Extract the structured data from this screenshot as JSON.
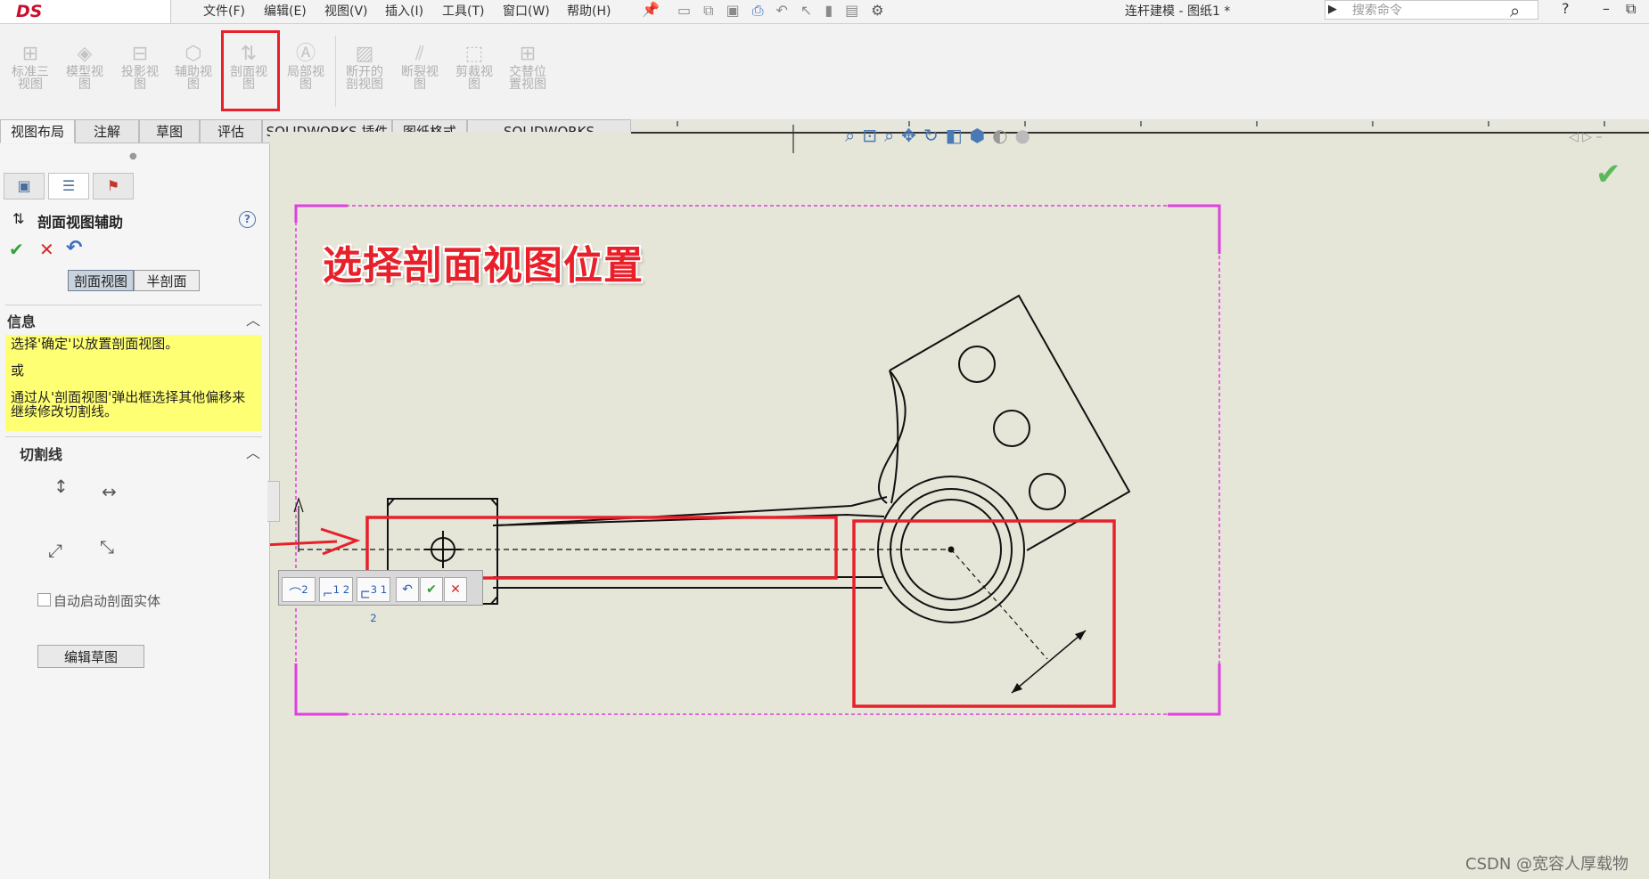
{
  "app": {
    "logo_text": "DS SOLIDWORKS",
    "window_title": "连杆建模 - 图纸1 *",
    "search_placeholder": "搜索命令",
    "help_symbol": "?"
  },
  "menu": [
    "文件(F)",
    "编辑(E)",
    "视图(V)",
    "插入(I)",
    "工具(T)",
    "窗口(W)",
    "帮助(H)"
  ],
  "ribbon": {
    "buttons": [
      {
        "l1": "标准三",
        "l2": "视图"
      },
      {
        "l1": "模型视",
        "l2": "图"
      },
      {
        "l1": "投影视",
        "l2": "图"
      },
      {
        "l1": "辅助视",
        "l2": "图"
      },
      {
        "l1": "剖面视",
        "l2": "图"
      },
      {
        "l1": "局部视",
        "l2": "图"
      },
      {
        "l1": "断开的",
        "l2": "剖视图"
      },
      {
        "l1": "断裂视",
        "l2": "图"
      },
      {
        "l1": "剪裁视",
        "l2": "图"
      },
      {
        "l1": "交替位",
        "l2": "置视图"
      }
    ]
  },
  "tabs": [
    "视图布局",
    "注解",
    "草图",
    "评估",
    "SOLIDWORKS 插件",
    "图纸格式",
    "SOLIDWORKS Inspection"
  ],
  "property_manager": {
    "title": "剖面视图辅助",
    "mode_buttons": [
      "剖面视图",
      "半剖面"
    ],
    "info_header": "信息",
    "info_lines": [
      "选择'确定'以放置剖面视图。",
      "或",
      "通过从'剖面视图'弹出框选择其他偏移来继续修改切割线。"
    ],
    "cutline_header": "切割线",
    "auto_start_label": "自动启动剖面实体",
    "edit_sketch_label": "编辑草图"
  },
  "canvas": {
    "headline": "选择剖面视图位置"
  },
  "popup_toolbar": {
    "labels": [
      "2",
      "1 2",
      "3 1 2"
    ]
  },
  "watermark": "CSDN @宽容人厚载物",
  "colors": {
    "annotation_red": "#e8202a",
    "sheet_border": "#e040e0",
    "canvas_bg": "#e5e5d8",
    "info_bg": "#ffff73"
  }
}
